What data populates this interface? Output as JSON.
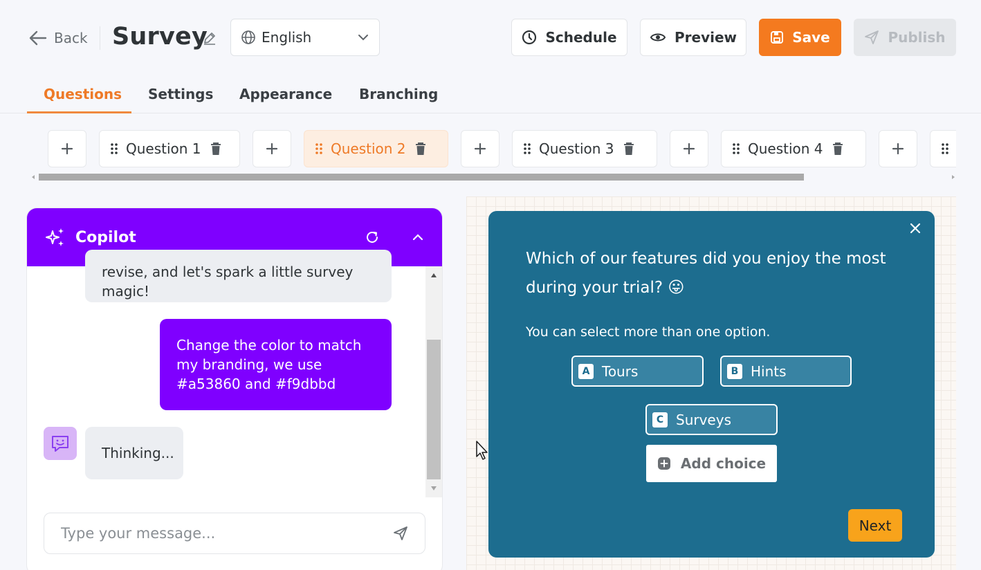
{
  "header": {
    "back_label": "Back",
    "title": "Survey",
    "language": "English",
    "schedule_label": "Schedule",
    "preview_label": "Preview",
    "save_label": "Save",
    "publish_label": "Publish"
  },
  "tabs": [
    {
      "label": "Questions",
      "active": true
    },
    {
      "label": "Settings"
    },
    {
      "label": "Appearance"
    },
    {
      "label": "Branching"
    }
  ],
  "questions": [
    {
      "label": "Question 1"
    },
    {
      "label": "Question 2",
      "active": true
    },
    {
      "label": "Question 3"
    },
    {
      "label": "Question 4"
    }
  ],
  "copilot": {
    "title": "Copilot",
    "messages": [
      {
        "from": "bot",
        "text": "revise, and let's spark a little survey magic!"
      },
      {
        "from": "user",
        "text": "Change the color to match my branding, we use #a53860 and #f9dbbd"
      },
      {
        "from": "bot",
        "text": "Thinking..."
      }
    ],
    "input_placeholder": "Type your message..."
  },
  "survey": {
    "question": "Which of our features did you enjoy the most during your trial? 😛",
    "subtitle": "You can select more than one option.",
    "choices": [
      {
        "letter": "A",
        "label": "Tours"
      },
      {
        "letter": "B",
        "label": "Hints"
      },
      {
        "letter": "C",
        "label": "Surveys"
      }
    ],
    "add_choice_label": "Add choice",
    "next_label": "Next"
  },
  "colors": {
    "accent_orange": "#f47a1f",
    "copilot_purple": "#7f00ff",
    "survey_bg": "#1d6d8f",
    "next_button": "#f8a31b"
  }
}
